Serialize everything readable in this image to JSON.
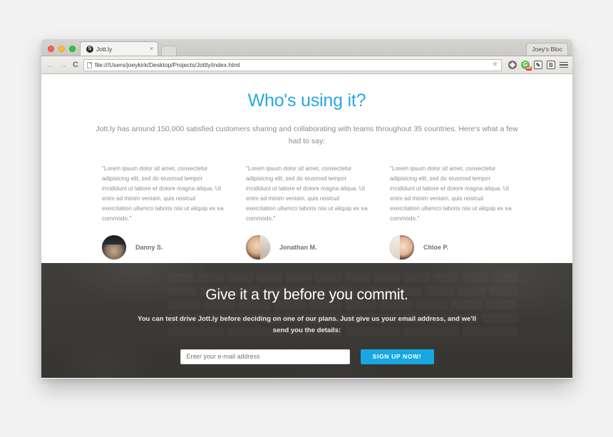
{
  "browser": {
    "traffic_lights": [
      "close",
      "minimize",
      "zoom"
    ],
    "tab": {
      "favicon_letter": "S",
      "favicon_name": "jottly-favicon",
      "title": "Jott.ly",
      "close_label": "×"
    },
    "new_tab_label": "",
    "profile_label": "Joey's Bloc",
    "toolbar": {
      "back_label": "←",
      "forward_label": "→",
      "reload_label": "C",
      "url": "file:///Users/joeykirk/Desktop/Projects/Jottly/index.html",
      "star_label": "★",
      "extensions": [
        {
          "name": "adblock-extension-icon",
          "label": ""
        },
        {
          "name": "ghostery-extension-icon",
          "label": "G",
          "badge": "off"
        },
        {
          "name": "edit-extension-icon",
          "label": "✎"
        },
        {
          "name": "bitly-extension-icon",
          "label": "B"
        },
        {
          "name": "chrome-menu-icon",
          "label": ""
        }
      ]
    }
  },
  "page": {
    "testimonials_section": {
      "headline": "Who's using it?",
      "subhead": "Jott.ly has around 150,000 satisfied customers sharing and collaborating with teams throughout 35 countries. Here's what a few had to say:",
      "items": [
        {
          "quote": "\"Lorem ipsum dolor sit amet, consectetur adipisicing elit, sed do eiusmod tempor incididunt ut labore et dolore magna aliqua. Ut enim ad minim veniam, quis nostrud exercitation ullamco laboris nisi ut aliquip ex ea commodo.\"",
          "name": "Danny S.",
          "avatar": "avatar-danny"
        },
        {
          "quote": "\"Lorem ipsum dolor sit amet, consectetur adipisicing elit, sed do eiusmod tempor incididunt ut labore et dolore magna aliqua. Ut enim ad minim veniam, quis nostrud exercitation ullamco laboris nisi ut aliquip ex ea commodo.\"",
          "name": "Jonathan M.",
          "avatar": "avatar-jonathan"
        },
        {
          "quote": "\"Lorem ipsum dolor sit amet, consectetur adipisicing elit, sed do eiusmod tempor incididunt ut labore et dolore magna aliqua. Ut enim ad minim veniam, quis nostrud exercitation ullamco laboris nisi ut aliquip ex ea commodo.\"",
          "name": "Chloe P.",
          "avatar": "avatar-chloe"
        }
      ]
    },
    "cta_section": {
      "headline": "Give it a try before you commit.",
      "subhead": "You can test drive Jott.ly before deciding on one of our plans. Just give us your email address, and we'll send you the details:",
      "email_placeholder": "Enter your e-mail address",
      "email_value": "",
      "signup_label": "SIGN UP NOW!"
    }
  },
  "colors": {
    "brand_blue": "#29a8e0",
    "button_blue": "#17a8e3",
    "dark_section": "#474440",
    "body_text": "#8e8e8e"
  }
}
